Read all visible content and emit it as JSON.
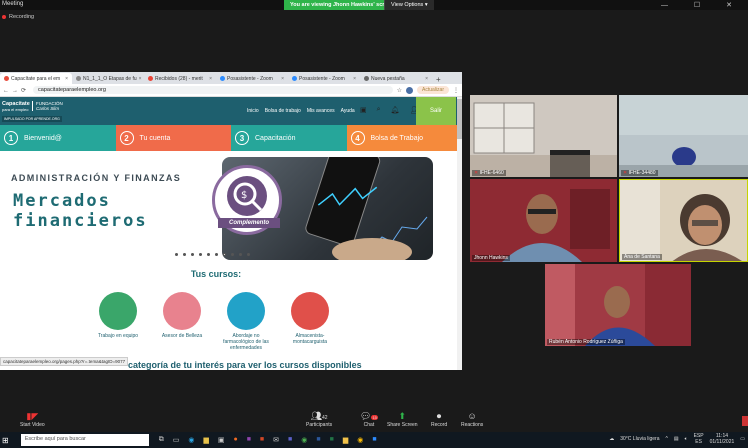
{
  "zoom": {
    "title": "Meeting",
    "viewing_banner": "You are viewing Jhonn Hawkins' screen",
    "view_options": "View Options",
    "recording": "Recording",
    "win_controls": "— ☐ ✕"
  },
  "browser": {
    "tabs": [
      {
        "label": "Capacítate para el em",
        "color": "#e74c3c",
        "active": true
      },
      {
        "label": "N1_1_1_O Etapas de fu",
        "color": "#888"
      },
      {
        "label": "Recibidos (28) - merit",
        "color": "#ea4335"
      },
      {
        "label": "Posasistente - Zoom",
        "color": "#2d8cff"
      },
      {
        "label": "Posasistente - Zoom",
        "color": "#2d8cff"
      },
      {
        "label": "Nueva pestaña",
        "color": "#666"
      }
    ],
    "url": "capacitateparaelempleo.org",
    "update_label": "Actualizar",
    "status_url": "capacitateparaelempleo.org/pages.php?r=.tema&tagID=9077"
  },
  "site": {
    "logo": "Capacítate",
    "logo_sub": "para el empleo",
    "logo2_line1": "FUNDACIÓN",
    "logo2_line2": "Carlos Slim",
    "impulsado": "IMPULSADO POR APRENDE.ORG",
    "nav": [
      "Inicio",
      "Bolsa de trabajo",
      "Mis avances",
      "Ayuda"
    ],
    "salir": "Salir",
    "steps": [
      {
        "num": "1",
        "label": "Bienvenid@",
        "color": "#26a69a"
      },
      {
        "num": "2",
        "label": "Tu cuenta",
        "color": "#f06b4a"
      },
      {
        "num": "3",
        "label": "Capacitación",
        "color": "#26a69a"
      },
      {
        "num": "4",
        "label": "Bolsa de Trabajo",
        "color": "#f58a3c"
      }
    ],
    "banner_small": "ADMINISTRACIÓN Y FINANZAS",
    "banner_line1": "Mercados",
    "banner_line2": "financieros",
    "complemento": "Complemento",
    "tus_cursos": "Tus cursos:",
    "courses": [
      {
        "label": "Trabajo en equipo",
        "color": "#3aa66a"
      },
      {
        "label": "Asesor de Belleza",
        "color": "#e8828e"
      },
      {
        "label": "Abordaje no farmacológico de las enfermedades",
        "color": "#22a2c8"
      },
      {
        "label": "Almacenista-montacarguista",
        "color": "#e0504a"
      }
    ],
    "select_text": "categoría de tu interés para ver los cursos disponibles"
  },
  "participants": [
    {
      "name": "IFHE-6460",
      "bg": "#c9c2bb"
    },
    {
      "name": "IFHE-34480",
      "bg": "#b7c4c9"
    },
    {
      "name": "Jhonn Hawkins",
      "bg": "#8e2a33"
    },
    {
      "name": "Ana de Santana",
      "bg": "#d8cdb8"
    },
    {
      "name": "Rubén Antonio Rodríguez Zúñiga",
      "bg": "#9a3840"
    }
  ],
  "toolbar": {
    "start_video": "Start Video",
    "participants": "Participants",
    "participants_count": "42",
    "chat": "Chat",
    "chat_badge": "15",
    "share_screen": "Share Screen",
    "record": "Record",
    "reactions": "Reactions"
  },
  "taskbar": {
    "search": "Escribe aquí para buscar",
    "weather": "30°C  Lluvia ligera",
    "lang": "ESP",
    "lang2": "ES",
    "time": "11:14",
    "date": "01/11/2021"
  }
}
